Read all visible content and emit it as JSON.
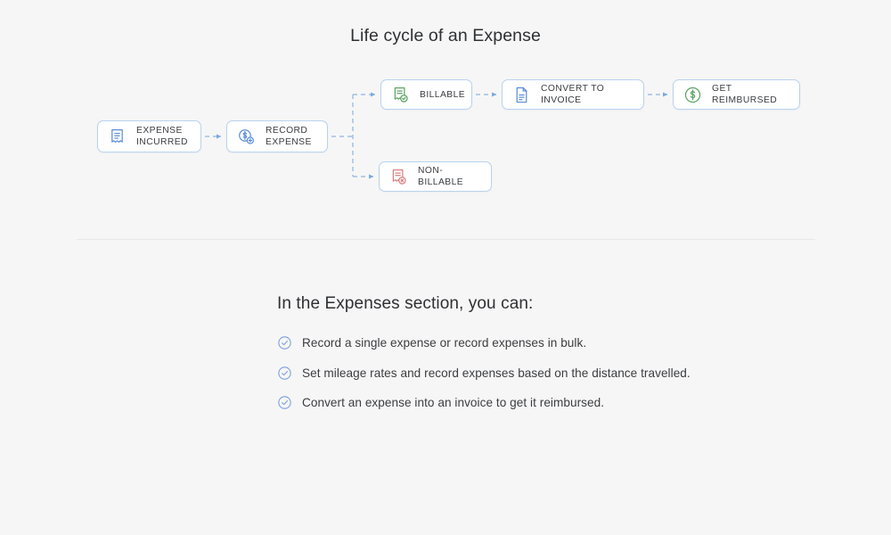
{
  "page": {
    "background_color": "#f6f6f6",
    "title": "Life cycle of an Expense"
  },
  "flow": {
    "nodes": [
      {
        "id": "expense-incurred",
        "label": "EXPENSE\nINCURRED",
        "icon": "receipt-icon",
        "icon_color": "#5b8dd6",
        "border_color": "#b9d2ef"
      },
      {
        "id": "record-expense",
        "label": "RECORD\nEXPENSE",
        "icon": "coin-dollar-add-icon",
        "icon_color": "#5b8dd6",
        "border_color": "#b9d2ef"
      },
      {
        "id": "billable",
        "label": "BILLABLE",
        "icon": "receipt-check-icon",
        "icon_color": "#5aa463",
        "border_color": "#b9d2ef"
      },
      {
        "id": "convert-to-invoice",
        "label": "CONVERT TO INVOICE",
        "icon": "document-icon",
        "icon_color": "#5b8dd6",
        "border_color": "#b9d2ef"
      },
      {
        "id": "get-reimbursed",
        "label": "GET REIMBURSED",
        "icon": "dollar-circle-icon",
        "icon_color": "#5aa463",
        "border_color": "#b9d2ef"
      },
      {
        "id": "non-billable",
        "label": "NON-BILLABLE",
        "icon": "receipt-cross-icon",
        "icon_color": "#d98080",
        "border_color": "#b9d2ef"
      }
    ],
    "connector_color": "#8fb4e0",
    "connector_style": "dashed-with-arrow"
  },
  "section": {
    "heading": "In the Expenses section, you can:",
    "bullet_icon": "circle-check-icon",
    "bullet_icon_color": "#7b9fe0",
    "items": [
      "Record a single expense or record expenses in bulk.",
      "Set mileage rates and record expenses based on the distance travelled.",
      "Convert an expense into an invoice to get it reimbursed."
    ]
  }
}
